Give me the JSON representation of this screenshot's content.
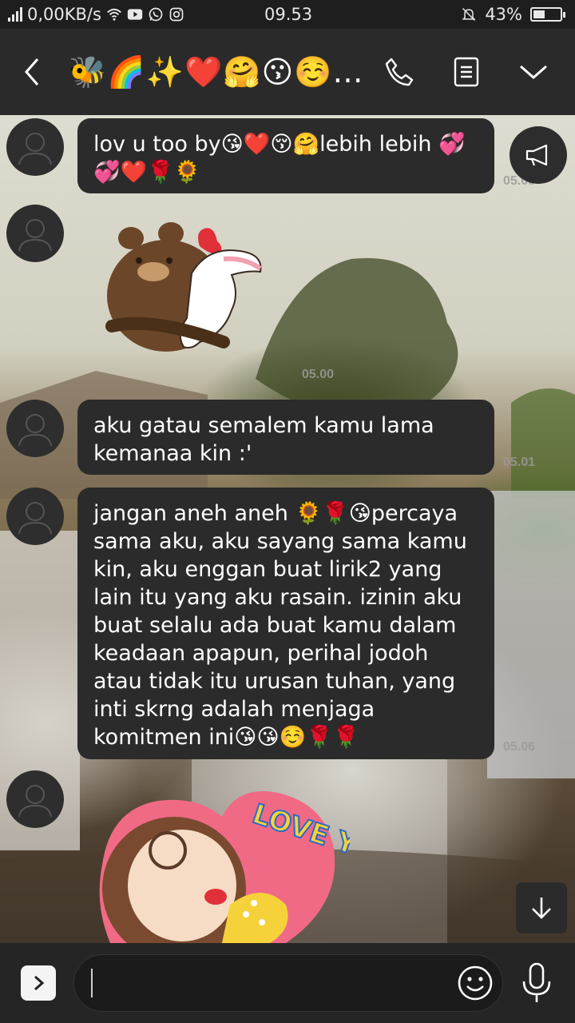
{
  "status_bar": {
    "network_speed": "0,00KB/s",
    "time": "09.53",
    "battery_percent": "43%",
    "battery_level": 0.43
  },
  "header": {
    "chat_title": "🐝🌈✨❤️🤗😗☺️…"
  },
  "messages": [
    {
      "type": "text",
      "text": "lov u too by😘❤️😚🤗lebih lebih 💞💞❤️🌹🌻",
      "time": "05.00"
    },
    {
      "type": "sticker",
      "sticker": "brown-cony-hug-sticker",
      "time": "05.00"
    },
    {
      "type": "text",
      "text": "aku gatau semalem kamu lama kemanaa kin :'",
      "time": "05.01"
    },
    {
      "type": "text",
      "text": "jangan aneh aneh 🌻🌹😘percaya sama aku, aku sayang sama kamu kin, aku enggan buat lirik2 yang lain itu yang aku rasain. izinin aku buat selalu ada buat kamu dalam keadaan apapun, perihal jodoh atau tidak itu urusan tuhan, yang inti skrng adalah menjaga komitmen ini😘😘☺️🌹🌹",
      "time": "05.06"
    },
    {
      "type": "sticker",
      "sticker": "love-you-sticker",
      "sticker_text": "LOVE YOU"
    }
  ],
  "input": {
    "placeholder": "",
    "value": ""
  },
  "colors": {
    "bubble": "#2b2b2b",
    "header": "#2a2a2a",
    "sticker_heart": "#e0303a",
    "love_text": "#f5d23a"
  }
}
